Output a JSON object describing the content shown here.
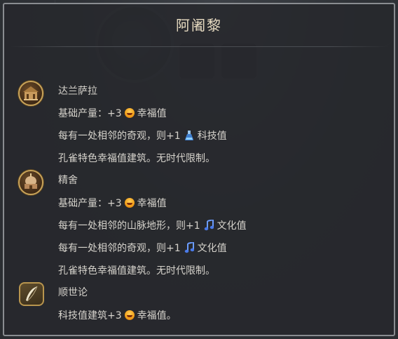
{
  "tooltip": {
    "title": "阿阇黎",
    "sections": [
      {
        "name": "达兰萨拉",
        "lines": [
          {
            "prefix": "基础产量：+3",
            "icon": "amenity-icon",
            "suffix": "幸福值"
          },
          {
            "prefix": "每有一处相邻的奇观，则+1",
            "icon": "science-icon",
            "suffix": "科技值"
          },
          {
            "prefix": "孔雀特色幸福值建筑。无时代限制。"
          }
        ]
      },
      {
        "name": "精舍",
        "lines": [
          {
            "prefix": "基础产量：+3",
            "icon": "amenity-icon",
            "suffix": "幸福值"
          },
          {
            "prefix": "每有一处相邻的山脉地形，则+1",
            "icon": "culture-icon",
            "suffix": "文化值"
          },
          {
            "prefix": "每有一处相邻的奇观，则+1",
            "icon": "culture-icon",
            "suffix": "文化值"
          },
          {
            "prefix": "孔雀特色幸福值建筑。无时代限制。"
          }
        ]
      },
      {
        "name": "顺世论",
        "lines": [
          {
            "prefix": "科技值建筑+3",
            "icon": "amenity-icon",
            "suffix": "幸福值。"
          }
        ]
      }
    ]
  },
  "colors": {
    "title": "#e8dcc2",
    "text": "#d6d3cc",
    "border": "#8a8d91",
    "badge_gold": "#c9a45a"
  }
}
